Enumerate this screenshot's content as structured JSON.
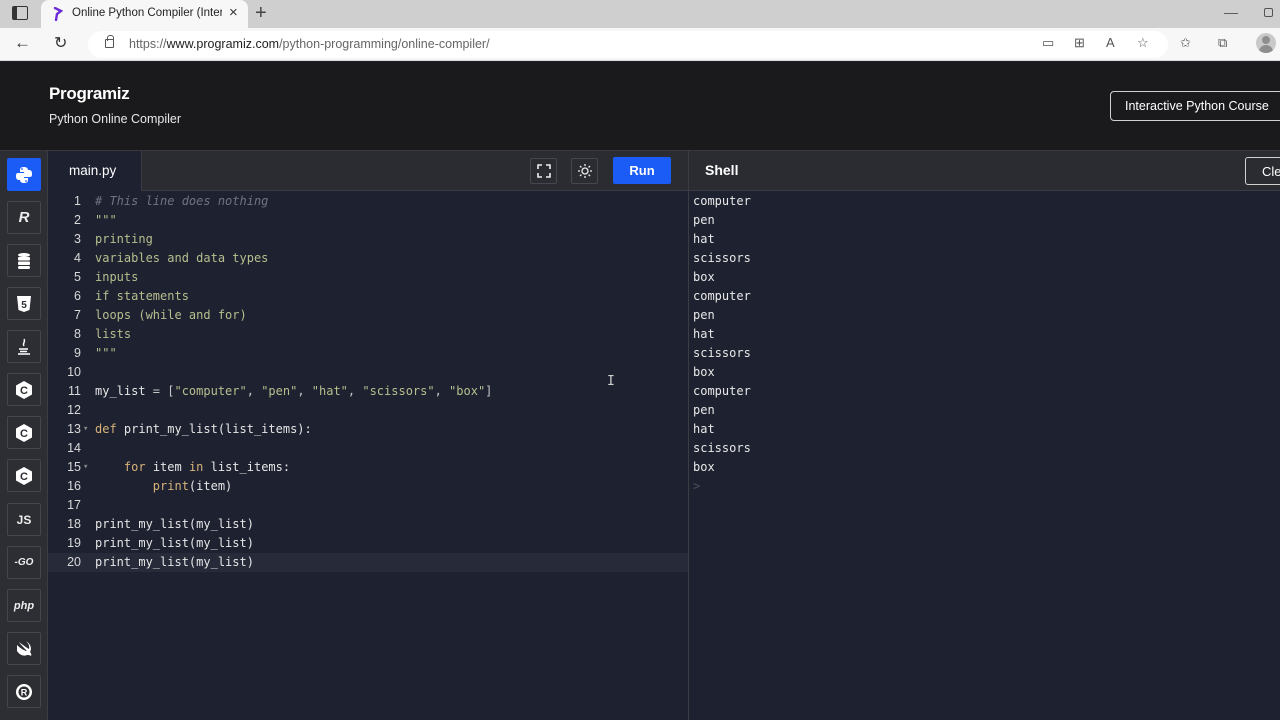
{
  "browser": {
    "tab_title": "Online Python Compiler (Interpreter)",
    "tab_close": "×",
    "new_tab": "+",
    "url_prefix": "https://",
    "url_domain": "www.programiz.com",
    "url_path": "/python-programming/online-compiler/",
    "toolbar_icons": [
      "device-icon",
      "apps-icon",
      "read-aloud-icon",
      "add-favorite-icon",
      "favorites-icon",
      "collections-icon",
      "profile-icon"
    ]
  },
  "header": {
    "logo": "Programiz",
    "subtitle": "Python Online Compiler",
    "course_button": "Interactive Python Course"
  },
  "sidebar": {
    "languages": [
      {
        "name": "python",
        "label": "",
        "active": true
      },
      {
        "name": "r",
        "label": "R"
      },
      {
        "name": "sql",
        "label": ""
      },
      {
        "name": "html",
        "label": "5"
      },
      {
        "name": "java",
        "label": ""
      },
      {
        "name": "c",
        "label": "C"
      },
      {
        "name": "cpp",
        "label": "C"
      },
      {
        "name": "csharp",
        "label": "C"
      },
      {
        "name": "javascript",
        "label": "JS"
      },
      {
        "name": "go",
        "label": "-GO"
      },
      {
        "name": "php",
        "label": "php"
      },
      {
        "name": "swift",
        "label": ""
      },
      {
        "name": "rust",
        "label": "R"
      }
    ]
  },
  "editor": {
    "file_tab": "main.py",
    "run_label": "Run",
    "active_line": 20,
    "lines": [
      {
        "n": "1",
        "tokens": [
          {
            "t": "comment",
            "v": "# This line does nothing"
          }
        ]
      },
      {
        "n": "2",
        "tokens": [
          {
            "t": "string",
            "v": "\"\"\""
          }
        ]
      },
      {
        "n": "3",
        "tokens": [
          {
            "t": "string",
            "v": "printing"
          }
        ]
      },
      {
        "n": "4",
        "tokens": [
          {
            "t": "string",
            "v": "variables and data types"
          }
        ]
      },
      {
        "n": "5",
        "tokens": [
          {
            "t": "string",
            "v": "inputs"
          }
        ]
      },
      {
        "n": "6",
        "tokens": [
          {
            "t": "string",
            "v": "if statements"
          }
        ]
      },
      {
        "n": "7",
        "tokens": [
          {
            "t": "string",
            "v": "loops (while and for)"
          }
        ]
      },
      {
        "n": "8",
        "tokens": [
          {
            "t": "string",
            "v": "lists"
          }
        ]
      },
      {
        "n": "9",
        "tokens": [
          {
            "t": "string",
            "v": "\"\"\""
          }
        ]
      },
      {
        "n": "10",
        "tokens": []
      },
      {
        "n": "11",
        "tokens": [
          {
            "t": "plain",
            "v": "my_list "
          },
          {
            "t": "op",
            "v": "= ["
          },
          {
            "t": "string",
            "v": "\"computer\""
          },
          {
            "t": "op",
            "v": ", "
          },
          {
            "t": "string",
            "v": "\"pen\""
          },
          {
            "t": "op",
            "v": ", "
          },
          {
            "t": "string",
            "v": "\"hat\""
          },
          {
            "t": "op",
            "v": ", "
          },
          {
            "t": "string",
            "v": "\"scissors\""
          },
          {
            "t": "op",
            "v": ", "
          },
          {
            "t": "string",
            "v": "\"box\""
          },
          {
            "t": "op",
            "v": "]"
          }
        ]
      },
      {
        "n": "12",
        "tokens": []
      },
      {
        "n": "13",
        "fold": true,
        "tokens": [
          {
            "t": "keyword",
            "v": "def "
          },
          {
            "t": "plain",
            "v": "print_my_list(list_items):"
          }
        ]
      },
      {
        "n": "14",
        "tokens": []
      },
      {
        "n": "15",
        "fold": true,
        "tokens": [
          {
            "t": "plain",
            "v": "    "
          },
          {
            "t": "keyword",
            "v": "for "
          },
          {
            "t": "plain",
            "v": "item "
          },
          {
            "t": "keyword",
            "v": "in "
          },
          {
            "t": "plain",
            "v": "list_items:"
          }
        ]
      },
      {
        "n": "16",
        "tokens": [
          {
            "t": "plain",
            "v": "        "
          },
          {
            "t": "keyword",
            "v": "print"
          },
          {
            "t": "plain",
            "v": "(item)"
          }
        ]
      },
      {
        "n": "17",
        "tokens": []
      },
      {
        "n": "18",
        "tokens": [
          {
            "t": "plain",
            "v": "print_my_list(my_list)"
          }
        ]
      },
      {
        "n": "19",
        "tokens": [
          {
            "t": "plain",
            "v": "print_my_list(my_list)"
          }
        ]
      },
      {
        "n": "20",
        "tokens": [
          {
            "t": "plain",
            "v": "print_my_list(my_list)"
          }
        ]
      }
    ]
  },
  "shell": {
    "title": "Shell",
    "clear_label": "Clear",
    "output": [
      "computer",
      "pen",
      "hat",
      "scissors",
      "box",
      "computer",
      "pen",
      "hat",
      "scissors",
      "box",
      "computer",
      "pen",
      "hat",
      "scissors",
      "box"
    ],
    "prompt": ">"
  },
  "colors": {
    "accent": "#1a5cf5",
    "editor_bg": "#1e2130",
    "header_bg": "#1a1a1c"
  }
}
